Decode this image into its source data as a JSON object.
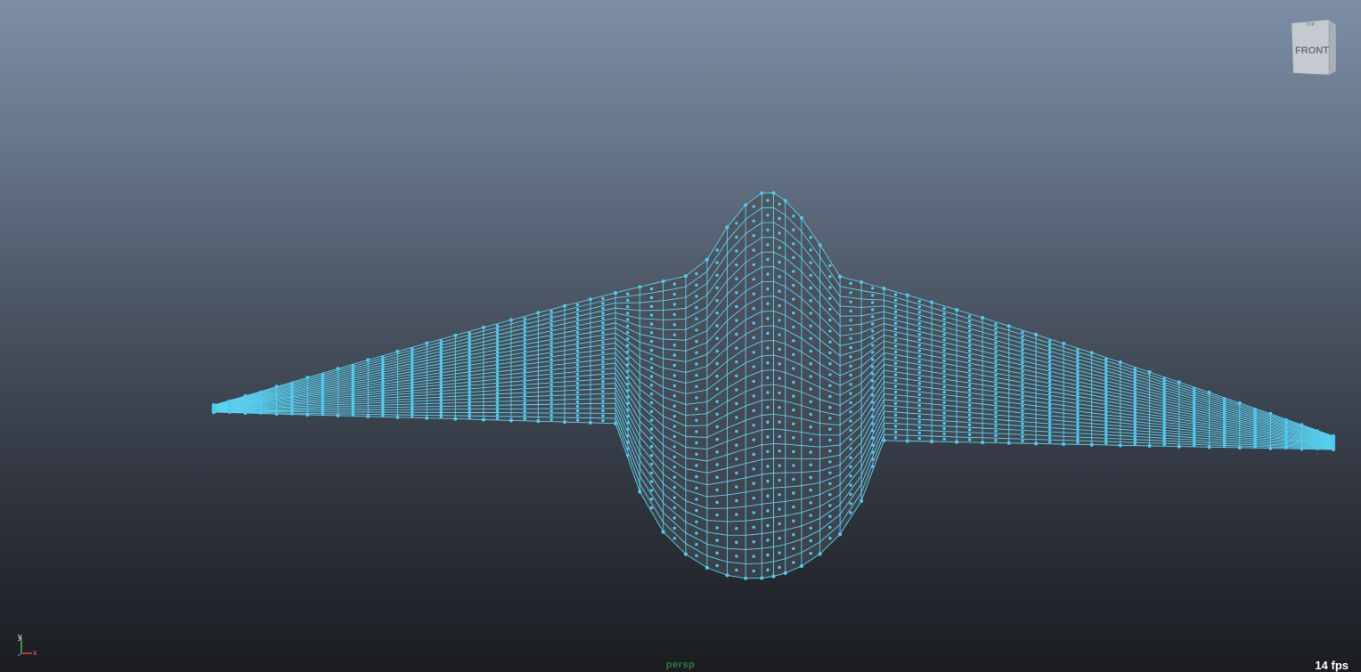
{
  "viewport": {
    "camera_name": "persp",
    "fps_text": "14 fps",
    "view_cube_face": "FRONT",
    "view_cube_top": "TOP",
    "axis": {
      "x_label": "x",
      "y_label": "y"
    }
  },
  "colors": {
    "wireframe": "#5ad0f0",
    "vertex": "#4fc8f0",
    "shell_top": "#505862",
    "shell_bottom": "#3a4048",
    "axis_x": "#e04040",
    "axis_y": "#40c040",
    "camera_label": "#2e7a3a"
  },
  "mesh": {
    "object": "nurbs-surface",
    "rows": 26,
    "cols": 44,
    "mode": "component-vertex"
  }
}
